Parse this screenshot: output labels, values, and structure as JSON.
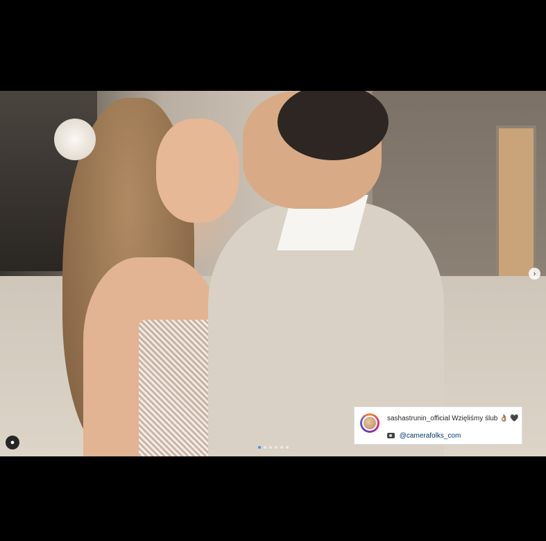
{
  "post": {
    "carousel": {
      "total": 6,
      "active": 1
    },
    "caption": {
      "username": "sashastrunin_official",
      "text": "Wzięliśmy ślub",
      "emoji_1": "👌🏽",
      "emoji_2": "🖤",
      "credit": "@camerafolks_com"
    },
    "controls": {
      "next_icon": "›",
      "user_tag_icon": "person-icon"
    }
  }
}
